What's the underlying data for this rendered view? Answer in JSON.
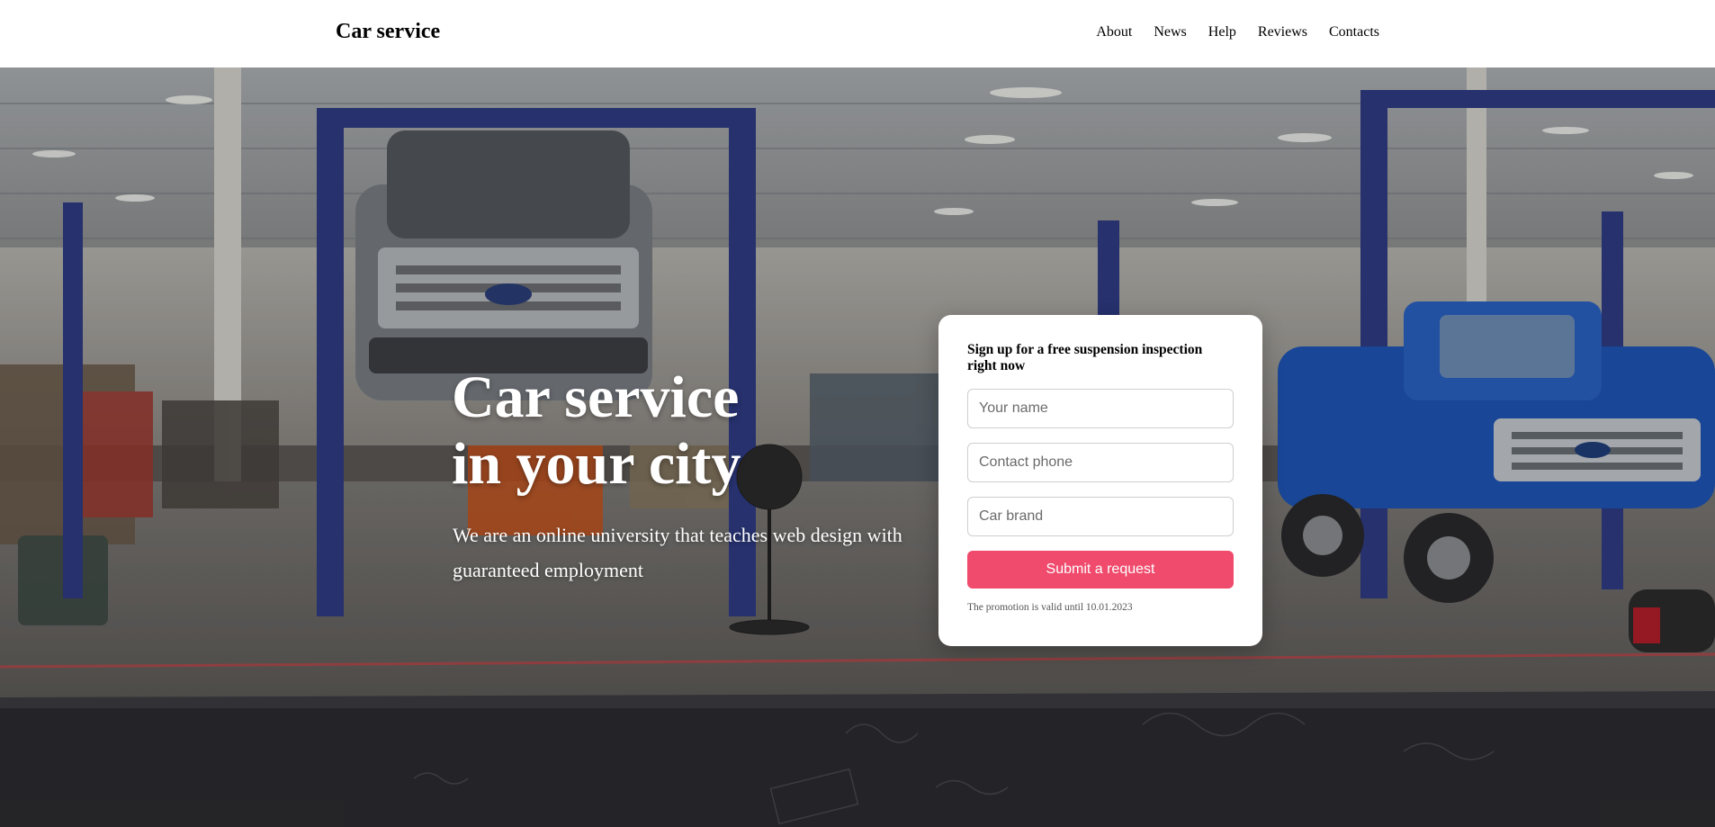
{
  "header": {
    "logo": "Car service",
    "nav": [
      "About",
      "News",
      "Help",
      "Reviews",
      "Contacts"
    ]
  },
  "hero": {
    "title_line1": "Car service",
    "title_line2": "in your city",
    "subtitle": "We are an online university that teaches web design with guaranteed employment",
    "background": "car-service-garage-photo"
  },
  "form": {
    "title": "Sign up for a free suspension inspection right now",
    "name_placeholder": "Your name",
    "phone_placeholder": "Contact phone",
    "brand_placeholder": "Car brand",
    "submit_label": "Submit a request",
    "note": "The promotion is valid until 10.01.2023"
  },
  "colors": {
    "accent": "#f04b6d",
    "text": "#000000",
    "card": "#ffffff"
  }
}
